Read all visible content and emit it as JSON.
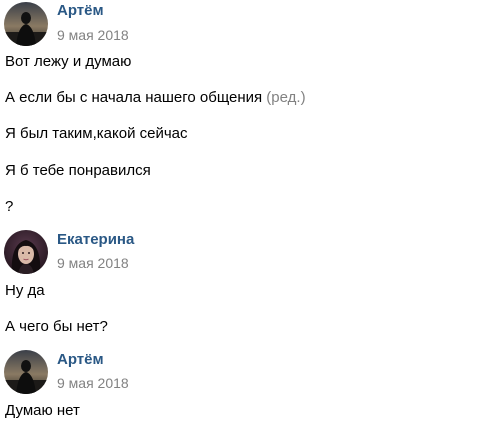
{
  "messages": [
    {
      "author": "Артём",
      "date": "9 мая 2018",
      "avatar": "artem-avatar",
      "lines": [
        {
          "text": "Вот лежу и думаю"
        },
        {
          "text": "А если бы с начала нашего общения",
          "edited": "(ред.)"
        },
        {
          "text": "Я был таким,какой сейчас"
        },
        {
          "text": "Я б тебе понравился"
        },
        {
          "text": "?"
        }
      ]
    },
    {
      "author": "Екатерина",
      "date": "9 мая 2018",
      "avatar": "ekaterina-avatar",
      "lines": [
        {
          "text": "Ну да"
        },
        {
          "text": "А чего бы нет?"
        }
      ]
    },
    {
      "author": "Артём",
      "date": "9 мая 2018",
      "avatar": "artem-avatar",
      "lines": [
        {
          "text": "Думаю нет"
        }
      ]
    }
  ],
  "colors": {
    "author": "#2a5885",
    "date": "#828282",
    "text": "#000000",
    "edited": "#828282"
  }
}
